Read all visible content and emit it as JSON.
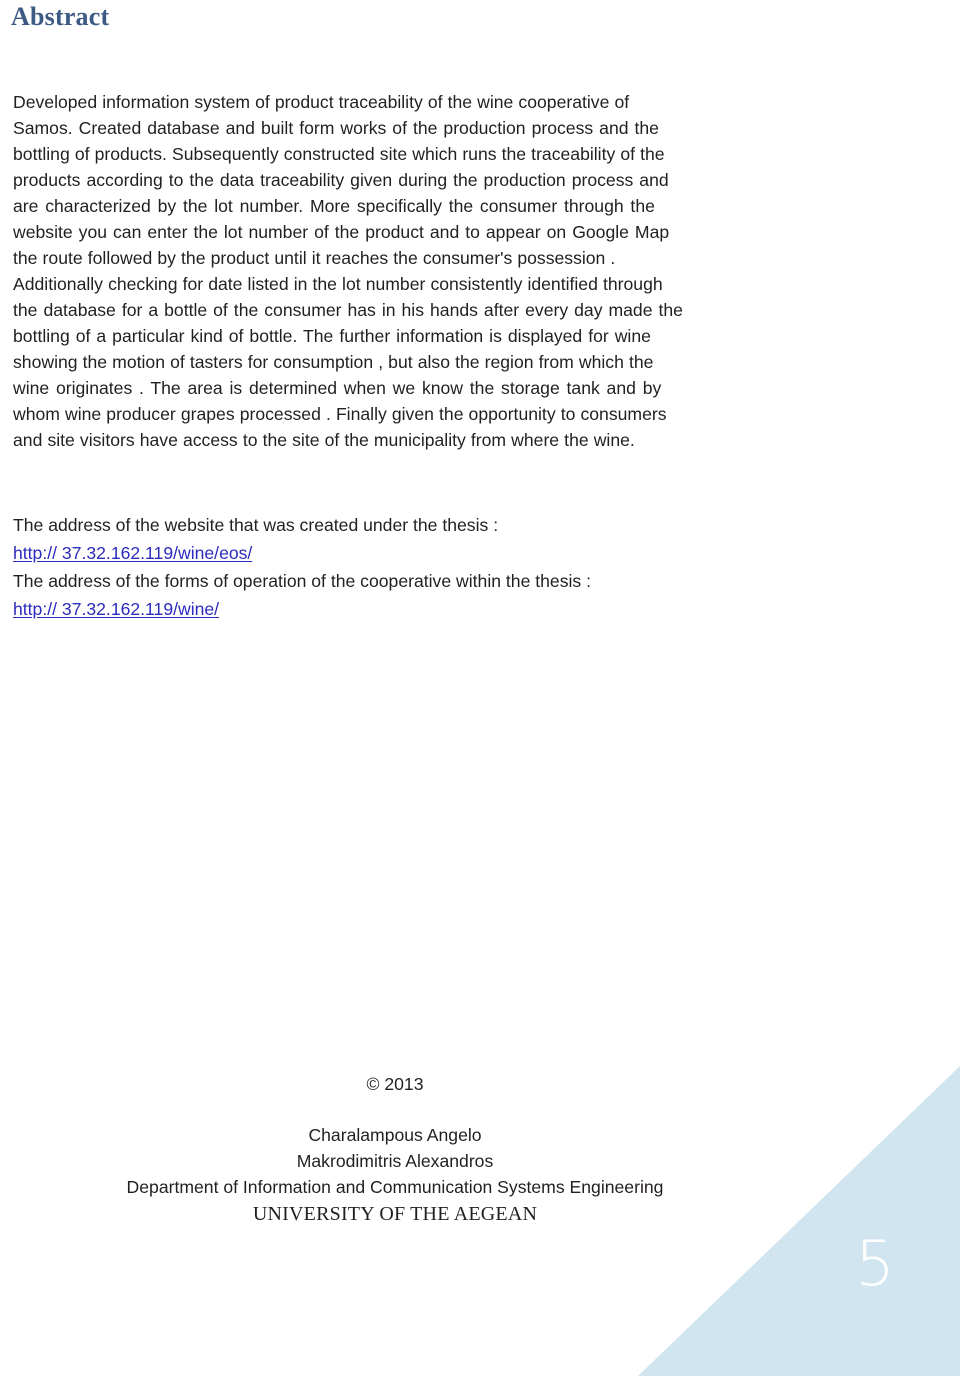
{
  "document": {
    "title": "Abstract",
    "title_color": "#3c5a84",
    "page_number": "5",
    "accent_color": "#d0e5ef",
    "link_color": "#2b2bbd",
    "text_color": "#231f20"
  },
  "abstract": {
    "full_text": "Developed information system of product traceability of the wine cooperative of Samos. Created database and built form works of the production process and the bottling of products. Subsequently constructed site which runs the traceability of the products according to the data traceability given during the production process and are characterized by the lot number. More specifically the consumer through the website you can enter the lot number of the product and to appear on Google Map the route followed by the product until it reaches the consumer's possession . Additionally checking for date listed in the lot number consistently identified through the database for a bottle of the consumer has in his hands after every day made the bottling of a particular kind of bottle. The further information is displayed for wine showing the motion of tasters for consumption , but also the region from which the wine originates . The area is determined when we know the storage tank and by whom wine producer grapes processed . Finally given the opportunity to consumers and site visitors have access to the site of the municipality from where the wine.",
    "lines": [
      "Developed information system of product traceability of the wine cooperative of",
      "Samos. Created database and built form works of the production process and the",
      "bottling of products. Subsequently constructed site which runs the traceability of the",
      "products according to the data traceability given during the production process and",
      "are characterized by the lot number. More specifically the consumer through the",
      "website you can enter the lot number of the product and to appear on Google Map",
      "the route followed by the product until it reaches the consumer's possession .",
      "Additionally checking for date listed in the lot number consistently identified through",
      "the database for a bottle of the consumer has in his hands after every day made the",
      "bottling of a particular kind of bottle. The further information is displayed for wine",
      "showing the motion of tasters for consumption , but also the region from which the",
      "wine originates . The area is determined when we know the storage tank and by",
      "whom wine producer grapes processed . Finally given the opportunity to consumers",
      "and site visitors have access to the site of the municipality from where the wine."
    ]
  },
  "links_section": {
    "website_label": "The address of the website that was created under the thesis :",
    "website_protocol": "http://",
    "website_url": " 37.32.162.119/wine/eos/",
    "forms_label": "The address of the forms of operation of the cooperative within the thesis :",
    "forms_protocol": "http://",
    "forms_url": " 37.32.162.119/wine/"
  },
  "footer": {
    "copyright": "© 2013",
    "author_one": "Charalampous Angelo",
    "author_two": "Makrodimitris Alexandros",
    "department": "Department of Information and Communication Systems Engineering",
    "university": "UNIVERSITY OF THE AEGEAN"
  }
}
